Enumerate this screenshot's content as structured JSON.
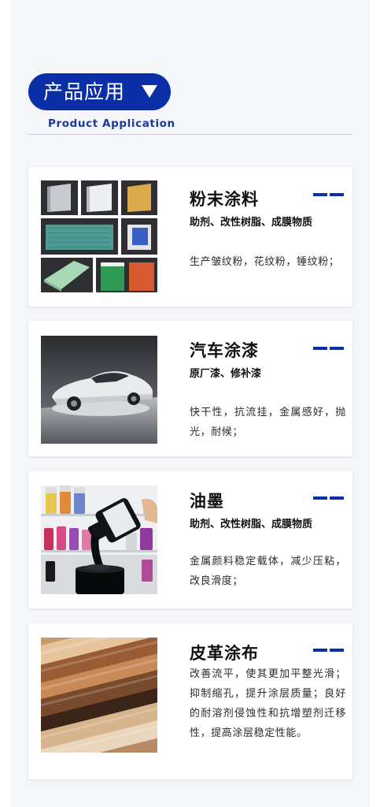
{
  "colors": {
    "brand_blue": "#0a2fa6",
    "sub_title_blue": "#1a3a9a",
    "panel_bg": "#f5f6fa",
    "card_bg": "#ffffff"
  },
  "header": {
    "title": "产品应用",
    "caret_icon": "caret-down-icon",
    "subtitle": "Product Application"
  },
  "cards": [
    {
      "title": "粉末涂料",
      "subtitle": "助剂、改性树脂、成膜物质",
      "description": "生产皱纹粉，花纹粉，锤纹粉；",
      "image": "powder-coating-panels-image"
    },
    {
      "title": "汽车涂漆",
      "subtitle": "原厂漆、修补漆",
      "description": "快干性，抗流挂，金属感好，抛光，耐候；",
      "image": "white-sports-car-image"
    },
    {
      "title": "油墨",
      "subtitle": "助剂、改性树脂、成膜物质",
      "description": "金属颜料稳定载体，减少压粘，改良滑度；",
      "image": "ink-pouring-image"
    },
    {
      "title": "皮革涂布",
      "subtitle": "",
      "description": "改善流平，使其更加平整光滑；抑制缩孔，提升涂层质量；良好的耐溶剂侵蚀性和抗增塑剂迁移性，提高涂层稳定性能。",
      "image": "leather-rolls-image"
    }
  ]
}
